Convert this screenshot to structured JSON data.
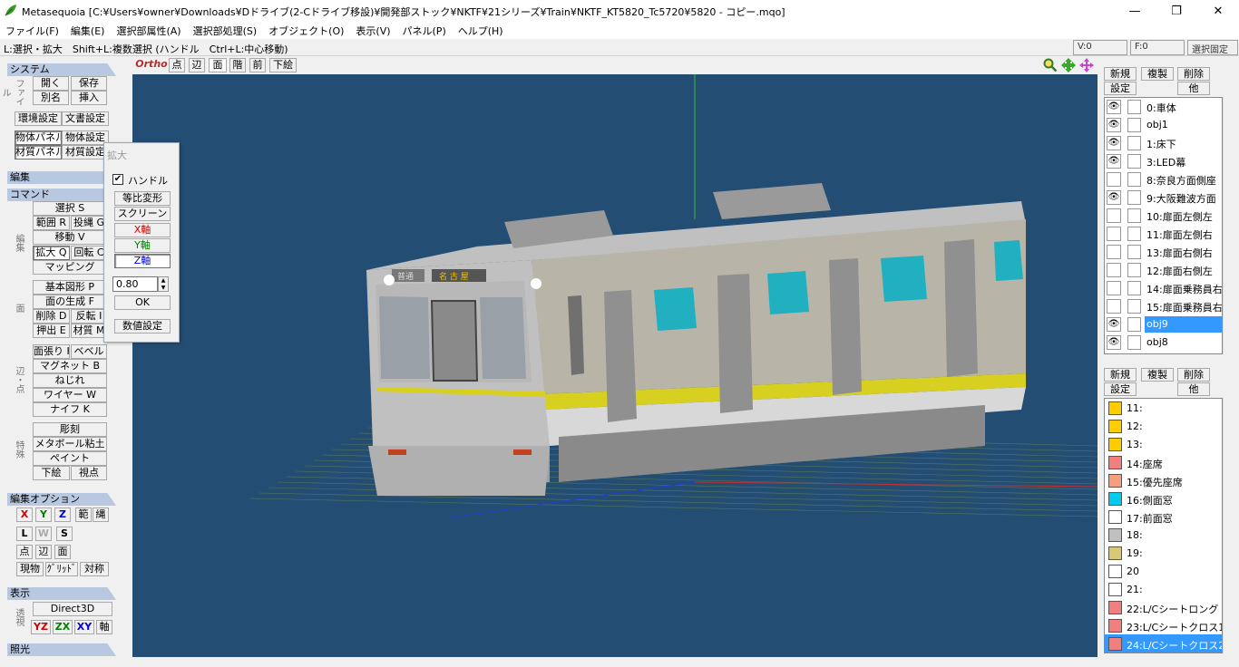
{
  "window": {
    "title": "Metasequoia [C:¥Users¥owner¥Downloads¥Dドライブ(2-Cドライブ移設)¥開発部ストック¥NKTF¥21シリーズ¥Train¥NKTF_KT5820_Tc5720¥5820 - コピー.mqo]",
    "minimize": "—",
    "maximize": "❐",
    "close": "✕"
  },
  "menu": [
    "ファイル(F)",
    "編集(E)",
    "選択部属性(A)",
    "選択部処理(S)",
    "オブジェクト(O)",
    "表示(V)",
    "パネル(P)",
    "ヘルプ(H)"
  ],
  "status": {
    "hint": "L:選択・拡大　Shift+L:複数選択 (ハンドル　Ctrl+L:中心移動)",
    "v": "V:0",
    "f": "F:0",
    "fix": "選択固定"
  },
  "left": {
    "system": "システム",
    "file_label": "ファイル",
    "open": "開く",
    "save": "保存",
    "saveas": "別名",
    "insert": "挿入",
    "env": "環境設定",
    "doc": "文書設定",
    "objpanel": "物体パネル",
    "objset": "物体設定",
    "matpanel": "材質パネル",
    "matset": "材質設定",
    "edit": "編集",
    "command": "コマンド",
    "select": "選択 S",
    "range": "範囲 R",
    "lasso": "投縄 G",
    "move": "移動 V",
    "scale": "拡大 Q",
    "rotate": "回転 C",
    "mapping": "マッピング",
    "edit_label": "編集",
    "basic": "基本図形 P",
    "facegen": "面の生成 F",
    "delete": "削除 D",
    "flip": "反転 I",
    "extrude": "押出 E",
    "material": "材質 M",
    "face_label": "面",
    "stretch": "面張り H",
    "bevel": "ベベル",
    "magnet": "マグネット B",
    "twist": "ねじれ",
    "wire": "ワイヤー W",
    "knife": "ナイフ K",
    "edge_label": "辺・点",
    "carve": "彫刻",
    "metaball": "メタボール粘土",
    "paint": "ペイント",
    "underlay": "下絵",
    "viewpoint": "視点",
    "special_label": "特殊",
    "editopt": "編集オプション",
    "x": "X",
    "y": "Y",
    "z": "Z",
    "rng": "範",
    "rope": "縄",
    "l": "L",
    "w": "W",
    "s": "S",
    "pt": "点",
    "ed": "辺",
    "fc": "面",
    "current": "現物",
    "grid": "ｸﾞﾘｯﾄﾞ",
    "sym": "対称",
    "display": "表示",
    "d3d": "Direct3D",
    "persp_label": "透視",
    "yz": "YZ",
    "zx": "ZX",
    "xy": "XY",
    "axis": "軸",
    "lighting": "照光"
  },
  "float": {
    "title": "拡大",
    "handle": "ハンドル",
    "handle_checked": "✔",
    "proportional": "等比変形",
    "screen": "スクリーン",
    "xaxis": "X軸",
    "yaxis": "Y軸",
    "zaxis": "Z軸",
    "value": "0.80",
    "ok": "OK",
    "numeric": "数値設定"
  },
  "viewport": {
    "ortho": "Ortho",
    "pt": "点",
    "ed": "辺",
    "fc": "面",
    "wire": "階",
    "front": "前",
    "underlay": "下絵",
    "dest_sign": "普通",
    "dest_sign2": "名 古 屋"
  },
  "right": {
    "new": "新規",
    "dup": "複製",
    "del": "削除",
    "set": "設定",
    "other": "他",
    "objects": [
      {
        "name": "0:車体",
        "visible": true
      },
      {
        "name": "obj1",
        "visible": true
      },
      {
        "name": "1:床下",
        "visible": true
      },
      {
        "name": "3:LED幕",
        "visible": true
      },
      {
        "name": "8:奈良方面側座",
        "visible": false
      },
      {
        "name": "9:大阪難波方面",
        "visible": true
      },
      {
        "name": "10:扉面左側左",
        "visible": false
      },
      {
        "name": "11:扉面左側右",
        "visible": false
      },
      {
        "name": "13:扉面右側右",
        "visible": false
      },
      {
        "name": "12:扉面右側左",
        "visible": false
      },
      {
        "name": "14:扉面乗務員右",
        "visible": false
      },
      {
        "name": "15:扉面乗務員右",
        "visible": false
      },
      {
        "name": "obj9",
        "visible": true,
        "selected": true
      },
      {
        "name": "obj8",
        "visible": true
      }
    ],
    "eye": "👁",
    "materials": [
      {
        "name": "11:",
        "color": "#ffcc00"
      },
      {
        "name": "12:",
        "color": "#ffcc00"
      },
      {
        "name": "13:",
        "color": "#ffcc00"
      },
      {
        "name": "14:座席",
        "color": "#f08080"
      },
      {
        "name": "15:優先座席",
        "color": "#f4a080"
      },
      {
        "name": "16:側面窓",
        "color": "#00ccee"
      },
      {
        "name": "17:前面窓",
        "color": "#ffffff"
      },
      {
        "name": "18:",
        "color": "#c0c0c0"
      },
      {
        "name": "19:",
        "color": "#d8c878"
      },
      {
        "name": "20",
        "color": "#ffffff"
      },
      {
        "name": "21:",
        "color": "#ffffff"
      },
      {
        "name": "22:L/Cシートロング",
        "color": "#f08080"
      },
      {
        "name": "23:L/Cシートクロス1",
        "color": "#f08080"
      },
      {
        "name": "24:L/Cシートクロス2",
        "color": "#f08080",
        "selected": true
      }
    ]
  }
}
